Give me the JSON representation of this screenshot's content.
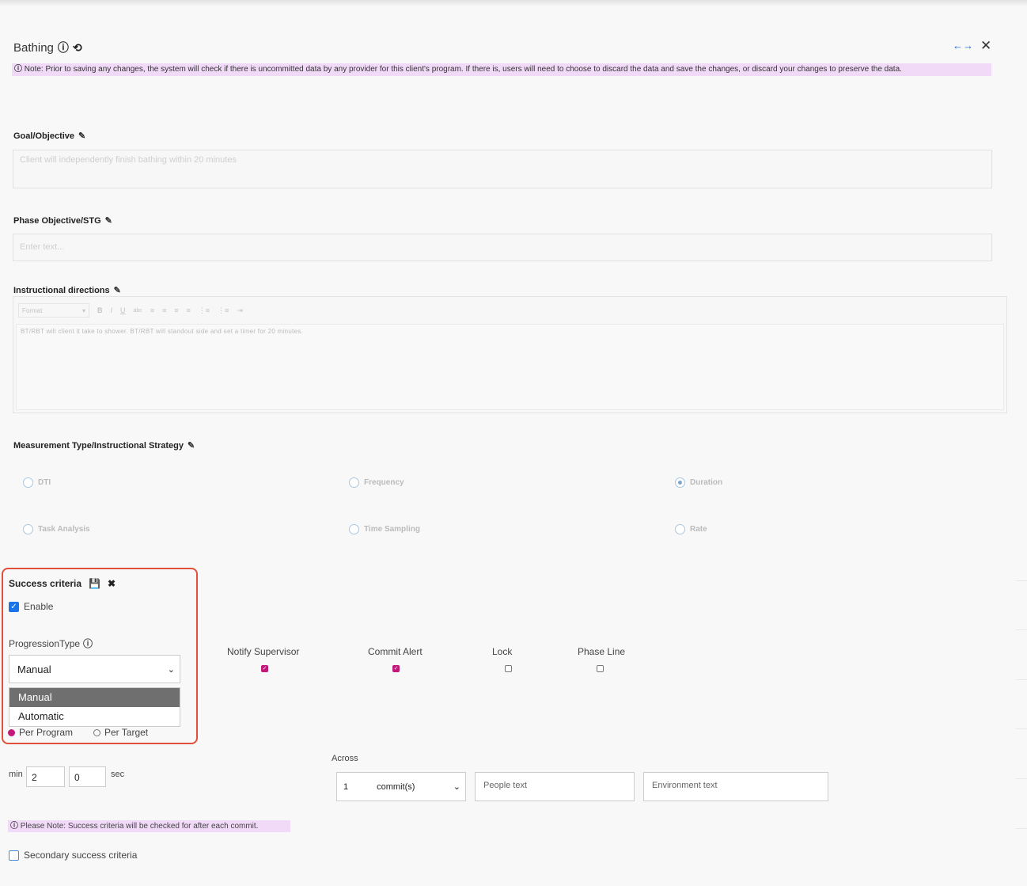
{
  "header": {
    "title": "Bathing",
    "note": "Note: Prior to saving any changes, the system will check if there is uncommitted data by any provider for this client's program. If there is, users will need to choose to discard the data and save the changes, or discard your changes to preserve the data."
  },
  "goal": {
    "label": "Goal/Objective",
    "placeholder": "Client will independently finish bathing within 20 minutes"
  },
  "phase": {
    "label": "Phase Objective/STG",
    "placeholder": "Enter text..."
  },
  "instructional": {
    "label": "Instructional directions",
    "format_label": "Format",
    "tool_bold": "B",
    "tool_italic": "I",
    "tool_underline": "U",
    "tool_strike": "abc",
    "body_text": "BT/RBT will client it take to shower. BT/RBT will standout side and set a timer for 20 minutes."
  },
  "measurement": {
    "label": "Measurement Type/Instructional Strategy",
    "options": [
      "DTI",
      "Frequency",
      "Duration",
      "Task Analysis",
      "Time Sampling",
      "Rate"
    ],
    "selected": "Duration"
  },
  "success": {
    "label": "Success criteria",
    "enable_label": "Enable",
    "enabled": true,
    "progression_label": "ProgressionType",
    "selected_value": "Manual",
    "dropdown_options": [
      "Manual",
      "Automatic"
    ],
    "per_program_label": "Per Program",
    "per_target_label": "Per Target",
    "notify_label": "Notify Supervisor",
    "notify_checked": true,
    "commit_label": "Commit Alert",
    "commit_checked": true,
    "lock_label": "Lock",
    "lock_checked": false,
    "phaseline_label": "Phase Line",
    "phaseline_checked": false,
    "min_label": "min",
    "min_value": "2",
    "sec_value": "0",
    "sec_label": "sec",
    "across_label": "Across",
    "commit_count": "1",
    "commit_unit": "commit(s)",
    "people_placeholder": "People text",
    "environment_placeholder": "Environment text",
    "note": "Please Note: Success criteria will be checked for after each commit.",
    "secondary_label": "Secondary success criteria",
    "secondary_checked": false
  },
  "colors": {
    "note_bg": "#f1d9f8",
    "highlight_border": "#e0503b",
    "checkbox_blue": "#1a73e8",
    "checkbox_magenta": "#c2187a"
  }
}
